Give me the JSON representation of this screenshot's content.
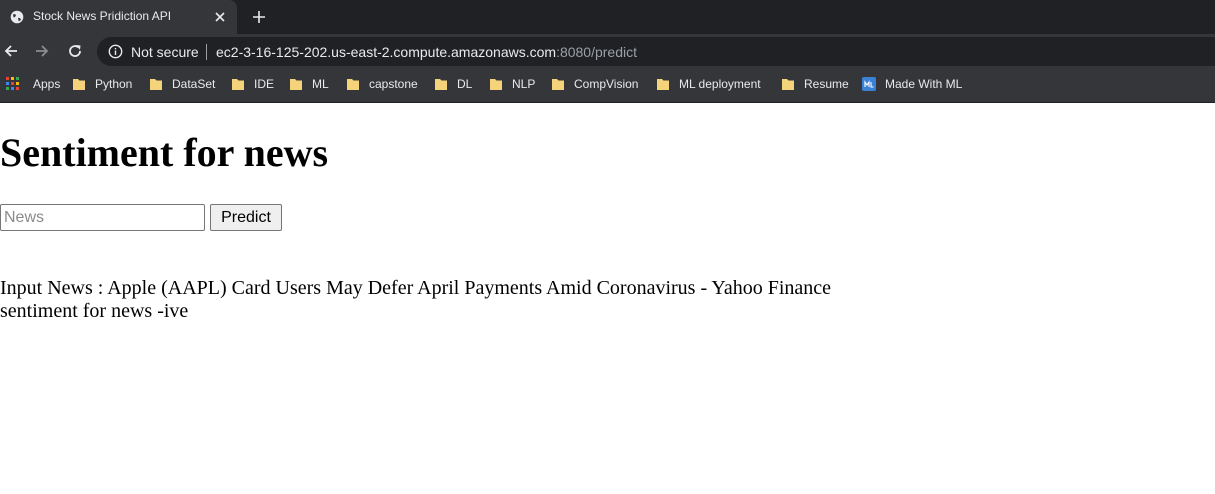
{
  "browser": {
    "tab": {
      "title": "Stock News Pridiction API"
    },
    "address": {
      "security_label": "Not secure",
      "url_host": "ec2-3-16-125-202.us-east-2.compute.amazonaws.com",
      "url_rest": ":8080/predict"
    },
    "bookmarks": [
      {
        "label": "Apps",
        "icon": "apps-grid-icon"
      },
      {
        "label": "Python",
        "icon": "folder-icon"
      },
      {
        "label": "DataSet",
        "icon": "folder-icon"
      },
      {
        "label": "IDE",
        "icon": "folder-icon"
      },
      {
        "label": "ML",
        "icon": "folder-icon"
      },
      {
        "label": "capstone",
        "icon": "folder-icon"
      },
      {
        "label": "DL",
        "icon": "folder-icon"
      },
      {
        "label": "NLP",
        "icon": "folder-icon"
      },
      {
        "label": "CompVision",
        "icon": "folder-icon"
      },
      {
        "label": "ML deployment",
        "icon": "folder-icon"
      },
      {
        "label": "Resume",
        "icon": "folder-icon"
      },
      {
        "label": "Made With ML",
        "icon": "made-with-ml-icon"
      }
    ]
  },
  "page": {
    "heading": "Sentiment for news",
    "form": {
      "input_placeholder": "News",
      "input_value": "",
      "button_label": "Predict"
    },
    "result": {
      "input_news_line": "Input News : Apple (AAPL) Card Users May Defer April Payments Amid Coronavirus - Yahoo Finance",
      "sentiment_line": "sentiment for news -ive"
    }
  },
  "colors": {
    "chrome_dark": "#202124",
    "chrome_toolbar": "#35363a",
    "chrome_text": "#e8eaed",
    "folder_yellow": "#f5d37a"
  }
}
